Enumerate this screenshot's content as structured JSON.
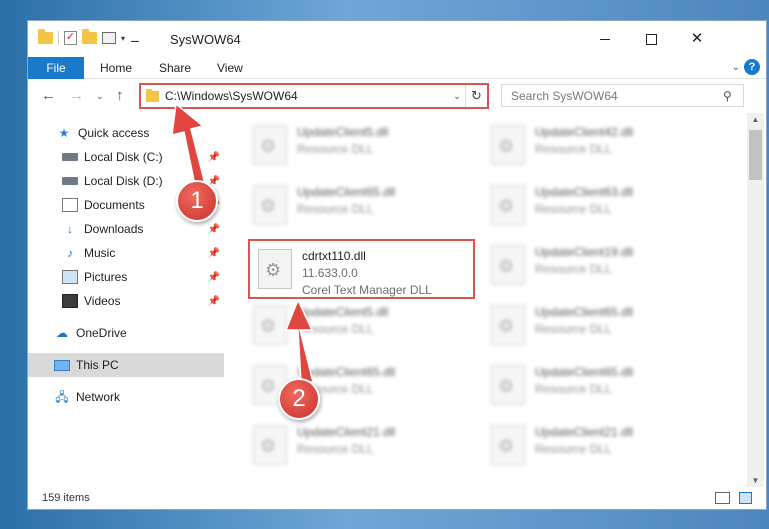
{
  "window": {
    "title": "SysWOW64"
  },
  "titlebar": {
    "qat_pin": "▾",
    "close_glyph": "✕"
  },
  "ribbon": {
    "tabs": [
      "File",
      "Home",
      "Share",
      "View"
    ],
    "expand_glyph": "⌄",
    "help_glyph": "?"
  },
  "nav": {
    "back_glyph": "←",
    "forward_glyph": "→",
    "recent_glyph": "⌄",
    "up_glyph": "↑",
    "address": "C:\\Windows\\SysWOW64",
    "dropdown_glyph": "⌄",
    "refresh_glyph": "↻",
    "search_placeholder": "Search SysWOW64",
    "search_glyph": "⚲"
  },
  "sidebar": {
    "items": [
      {
        "label": "Quick access",
        "icon": "star-icon",
        "pinned": false
      },
      {
        "label": "Local Disk (C:)",
        "icon": "disk-icon",
        "pinned": true
      },
      {
        "label": "Local Disk (D:)",
        "icon": "disk-icon",
        "pinned": true
      },
      {
        "label": "Documents",
        "icon": "documents-icon",
        "pinned": true
      },
      {
        "label": "Downloads",
        "icon": "downloads-icon",
        "pinned": true
      },
      {
        "label": "Music",
        "icon": "music-icon",
        "pinned": true
      },
      {
        "label": "Pictures",
        "icon": "pictures-icon",
        "pinned": true
      },
      {
        "label": "Videos",
        "icon": "videos-icon",
        "pinned": true
      },
      {
        "label": "OneDrive",
        "icon": "onedrive-icon",
        "pinned": false
      },
      {
        "label": "This PC",
        "icon": "this-pc-icon",
        "pinned": false,
        "selected": true
      },
      {
        "label": "Network",
        "icon": "network-icon",
        "pinned": false
      }
    ]
  },
  "files": {
    "left": [
      {
        "name": "UpdateClient5.dll",
        "desc": "Resource DLL"
      },
      {
        "name": "UpdateClient65.dll",
        "desc": "Resource DLL"
      },
      {
        "name": "cdrtxt110.dll",
        "version": "11.633.0.0",
        "desc": "Corel Text Manager DLL"
      },
      {
        "name": "UpdateClient5.dll",
        "desc": "Resource DLL"
      },
      {
        "name": "UpdateClient65.dll",
        "desc": "Resource DLL"
      },
      {
        "name": "UpdateClient21.dll",
        "desc": "Resource DLL"
      }
    ],
    "right": [
      {
        "name": "UpdateClient42.dll",
        "desc": "Resource DLL"
      },
      {
        "name": "UpdateClient63.dll",
        "desc": "Resource DLL"
      },
      {
        "name": "UpdateClient19.dll",
        "desc": "Resource DLL"
      },
      {
        "name": "UpdateClient65.dll",
        "desc": "Resource DLL"
      },
      {
        "name": "UpdateClient65.dll",
        "desc": "Resource DLL"
      },
      {
        "name": "UpdateClient21.dll",
        "desc": "Resource DLL"
      }
    ]
  },
  "status": {
    "items": "159 items"
  },
  "annotations": {
    "step1": "1",
    "step2": "2"
  },
  "colors": {
    "accent": "#1979ca",
    "highlight": "#d9534f",
    "selected": "#d9d9d9"
  }
}
